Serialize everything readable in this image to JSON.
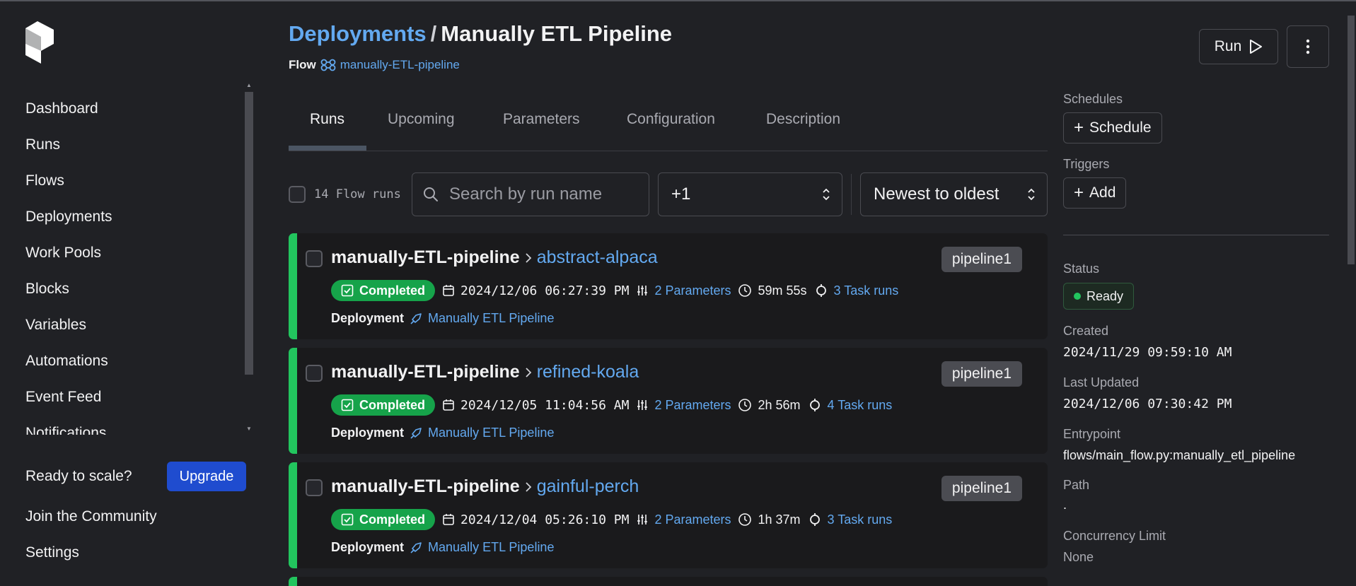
{
  "sidebar": {
    "items": [
      {
        "label": "Dashboard"
      },
      {
        "label": "Runs"
      },
      {
        "label": "Flows"
      },
      {
        "label": "Deployments"
      },
      {
        "label": "Work Pools"
      },
      {
        "label": "Blocks"
      },
      {
        "label": "Variables"
      },
      {
        "label": "Automations"
      },
      {
        "label": "Event Feed"
      },
      {
        "label": "Notifications"
      }
    ],
    "ready_label": "Ready to scale?",
    "upgrade_label": "Upgrade",
    "community_label": "Join the Community",
    "settings_label": "Settings"
  },
  "header": {
    "breadcrumb": "Deployments",
    "separator": "/",
    "title": "Manually ETL Pipeline",
    "flow_label": "Flow",
    "flow_name": "manually-ETL-pipeline",
    "run_label": "Run"
  },
  "tabs": [
    {
      "label": "Runs"
    },
    {
      "label": "Upcoming"
    },
    {
      "label": "Parameters"
    },
    {
      "label": "Configuration"
    },
    {
      "label": "Description"
    }
  ],
  "filters": {
    "count_text": "14 Flow runs",
    "search_placeholder": "Search by run name",
    "state_filter": "+1",
    "sort": "Newest to oldest"
  },
  "runs": [
    {
      "flow": "manually-ETL-pipeline",
      "name": "abstract-alpaca",
      "tag": "pipeline1",
      "state": "Completed",
      "start": "2024/12/06 06:27:39 PM",
      "params": "2 Parameters",
      "duration": "59m 55s",
      "tasks": "3 Task runs",
      "deploy_label": "Deployment",
      "deployment": "Manually ETL Pipeline"
    },
    {
      "flow": "manually-ETL-pipeline",
      "name": "refined-koala",
      "tag": "pipeline1",
      "state": "Completed",
      "start": "2024/12/05 11:04:56 AM",
      "params": "2 Parameters",
      "duration": "2h 56m",
      "tasks": "4 Task runs",
      "deploy_label": "Deployment",
      "deployment": "Manually ETL Pipeline"
    },
    {
      "flow": "manually-ETL-pipeline",
      "name": "gainful-perch",
      "tag": "pipeline1",
      "state": "Completed",
      "start": "2024/12/04 05:26:10 PM",
      "params": "2 Parameters",
      "duration": "1h 37m",
      "tasks": "3 Task runs",
      "deploy_label": "Deployment",
      "deployment": "Manually ETL Pipeline"
    }
  ],
  "details": {
    "schedules_label": "Schedules",
    "schedule_btn": "Schedule",
    "triggers_label": "Triggers",
    "add_btn": "Add",
    "status_label": "Status",
    "status_value": "Ready",
    "created_label": "Created",
    "created_value": "2024/11/29 09:59:10 AM",
    "updated_label": "Last Updated",
    "updated_value": "2024/12/06 07:30:42 PM",
    "entrypoint_label": "Entrypoint",
    "entrypoint_value": "flows/main_flow.py:manually_etl_pipeline",
    "path_label": "Path",
    "path_value": ".",
    "concurrency_label": "Concurrency Limit",
    "concurrency_value": "None"
  },
  "colors": {
    "background": "#202125",
    "card": "#1a1a1c",
    "accent_link": "#63a9f0",
    "completed": "#16a34a",
    "upgrade": "#1f4ccf"
  }
}
